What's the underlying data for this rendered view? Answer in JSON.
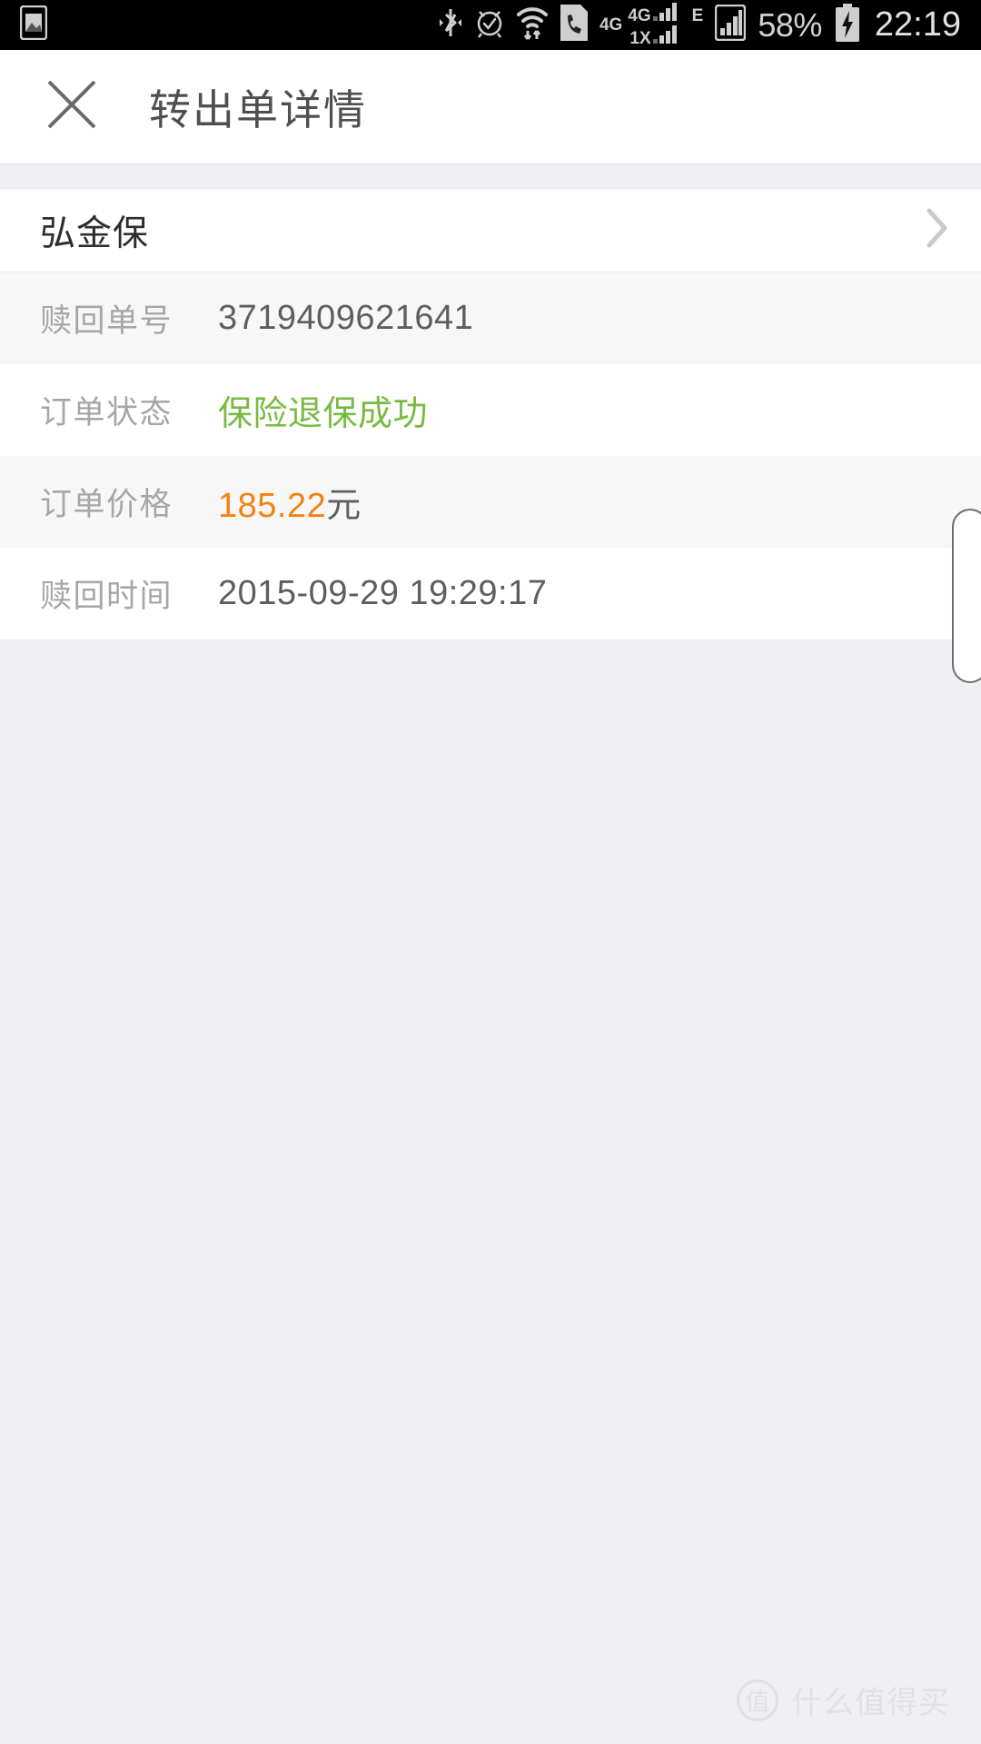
{
  "statusbar": {
    "icons_left": [
      "photo-icon"
    ],
    "icons_right": [
      "bluetooth-icon",
      "alarm-icon",
      "wifi-icon",
      "sim-call-icon",
      "signal-4g-icon",
      "signal-1x-icon",
      "edge-icon",
      "signal-bars-icon"
    ],
    "network_primary": "4G",
    "network_secondary": "4G",
    "network_tertiary": "1X",
    "network_edge": "E",
    "battery_percent": "58%",
    "clock": "22:19"
  },
  "header": {
    "close_icon": "close-icon",
    "title": "转出单详情"
  },
  "product": {
    "name": "弘金保",
    "chevron_icon": "chevron-right-icon"
  },
  "details": [
    {
      "label": "赎回单号",
      "value": "3719409621641",
      "style": "default"
    },
    {
      "label": "订单状态",
      "value": "保险退保成功",
      "style": "green"
    },
    {
      "label": "订单价格",
      "value": "185.22",
      "unit": "元",
      "style": "price"
    },
    {
      "label": "赎回时间",
      "value": "2015-09-29 19:29:17",
      "style": "default"
    }
  ],
  "colors": {
    "status_success": "#77bb41",
    "price_accent": "#f68010",
    "page_background": "#f0eff4",
    "row_alt": "#f7f7f8"
  },
  "watermark": {
    "badge": "值",
    "text": "什么值得买"
  }
}
